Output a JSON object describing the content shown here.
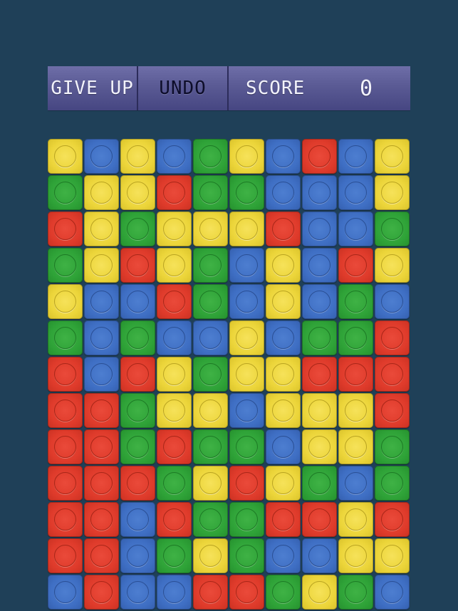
{
  "toolbar": {
    "give_up_label": "GIVE UP",
    "undo_label": "UNDO",
    "score_label": "SCORE",
    "score_value": "0"
  },
  "colors": {
    "background": "#1f4058",
    "yellow": "#ecd53a",
    "blue": "#3f6fc4",
    "green": "#2fa338",
    "red": "#df3b2b"
  },
  "board": {
    "rows": [
      [
        "yellow",
        "blue",
        "yellow",
        "blue",
        "green",
        "yellow",
        "blue",
        "red",
        "blue",
        "yellow"
      ],
      [
        "green",
        "yellow",
        "yellow",
        "red",
        "green",
        "green",
        "blue",
        "blue",
        "blue",
        "yellow"
      ],
      [
        "red",
        "yellow",
        "green",
        "yellow",
        "yellow",
        "yellow",
        "red",
        "blue",
        "blue",
        "green"
      ],
      [
        "green",
        "yellow",
        "red",
        "yellow",
        "green",
        "blue",
        "yellow",
        "blue",
        "red",
        "yellow"
      ],
      [
        "yellow",
        "blue",
        "blue",
        "red",
        "green",
        "blue",
        "yellow",
        "blue",
        "green",
        "blue"
      ],
      [
        "green",
        "blue",
        "green",
        "blue",
        "blue",
        "yellow",
        "blue",
        "green",
        "green",
        "red"
      ],
      [
        "red",
        "blue",
        "red",
        "yellow",
        "green",
        "yellow",
        "yellow",
        "red",
        "red",
        "red"
      ],
      [
        "red",
        "red",
        "green",
        "yellow",
        "yellow",
        "blue",
        "yellow",
        "yellow",
        "yellow",
        "red"
      ],
      [
        "red",
        "red",
        "green",
        "red",
        "green",
        "green",
        "blue",
        "yellow",
        "yellow",
        "green"
      ],
      [
        "red",
        "red",
        "red",
        "green",
        "yellow",
        "red",
        "yellow",
        "green",
        "blue",
        "green"
      ],
      [
        "red",
        "red",
        "blue",
        "red",
        "green",
        "green",
        "red",
        "red",
        "yellow",
        "red"
      ],
      [
        "red",
        "red",
        "blue",
        "green",
        "yellow",
        "green",
        "blue",
        "blue",
        "yellow",
        "yellow"
      ],
      [
        "blue",
        "red",
        "blue",
        "blue",
        "red",
        "red",
        "green",
        "yellow",
        "green",
        "blue"
      ]
    ]
  }
}
